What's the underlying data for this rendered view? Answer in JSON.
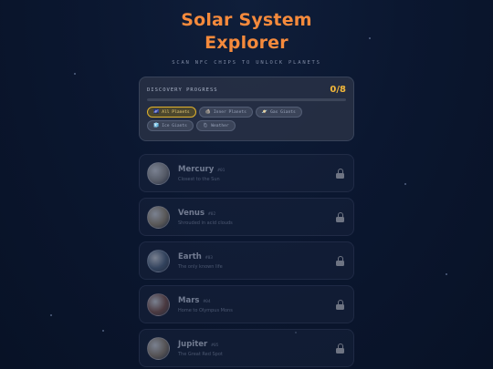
{
  "header": {
    "title_line1": "Solar System",
    "title_line2": "Explorer",
    "subtitle": "SCAN NFC CHIPS TO UNLOCK PLANETS"
  },
  "progress": {
    "label": "DISCOVERY PROGRESS",
    "count": "0/8",
    "fraction": 0
  },
  "filters": [
    {
      "icon": "🌌",
      "label": "All Planets",
      "active": true
    },
    {
      "icon": "🪨",
      "label": "Inner Planets",
      "active": false
    },
    {
      "icon": "🪐",
      "label": "Gas Giants",
      "active": false
    },
    {
      "icon": "🧊",
      "label": "Ice Giants",
      "active": false
    },
    {
      "icon": "🌦",
      "label": "Weather",
      "active": false
    }
  ],
  "planets": [
    {
      "name": "Mercury",
      "num": "#01",
      "desc": "Closest to the Sun",
      "icon": "planet-mercury-icon",
      "color": "#6b6e77"
    },
    {
      "name": "Venus",
      "num": "#02",
      "desc": "Shrouded in acid clouds",
      "icon": "planet-venus-icon",
      "color": "#6f6a63"
    },
    {
      "name": "Earth",
      "num": "#03",
      "desc": "The only known life",
      "icon": "planet-earth-icon",
      "color": "#3d4f6a"
    },
    {
      "name": "Mars",
      "num": "#04",
      "desc": "Home to Olympus Mons",
      "icon": "planet-mars-icon",
      "color": "#5d4446"
    },
    {
      "name": "Jupiter",
      "num": "#05",
      "desc": "The Great Red Spot",
      "icon": "planet-jupiter-icon",
      "color": "#6a6460"
    }
  ]
}
